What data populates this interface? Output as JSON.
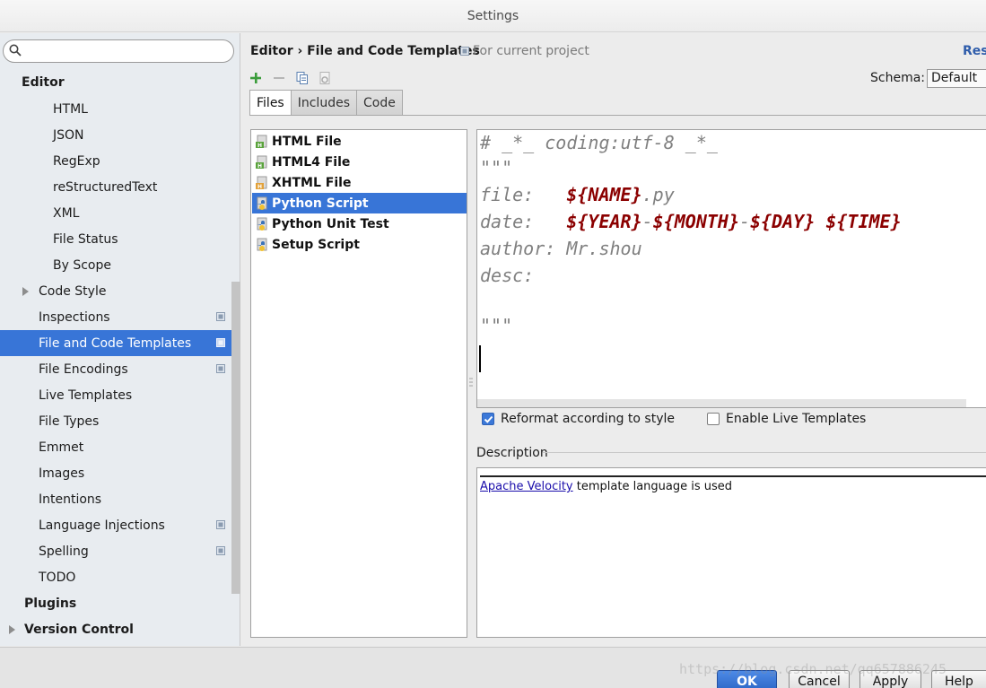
{
  "window": {
    "title": "Settings"
  },
  "search": {
    "placeholder": "",
    "value": ""
  },
  "tree": [
    {
      "label": "Editor",
      "bold": true
    },
    {
      "label": "HTML"
    },
    {
      "label": "JSON"
    },
    {
      "label": "RegExp"
    },
    {
      "label": "reStructuredText"
    },
    {
      "label": "XML"
    },
    {
      "label": "File Status"
    },
    {
      "label": "By Scope"
    },
    {
      "label": "Code Style",
      "expandable": true
    },
    {
      "label": "Inspections",
      "project_icon": true
    },
    {
      "label": "File and Code Templates",
      "selected": true,
      "project_icon": true
    },
    {
      "label": "File Encodings",
      "project_icon": true
    },
    {
      "label": "Live Templates"
    },
    {
      "label": "File Types"
    },
    {
      "label": "Emmet"
    },
    {
      "label": "Images"
    },
    {
      "label": "Intentions"
    },
    {
      "label": "Language Injections",
      "project_icon": true
    },
    {
      "label": "Spelling",
      "project_icon": true
    },
    {
      "label": "TODO"
    },
    {
      "label": "Plugins",
      "bold": true
    },
    {
      "label": "Version Control",
      "bold": true,
      "expandable": true
    }
  ],
  "header": {
    "breadcrumb": "Editor › File and Code Templates",
    "scope": "For current project",
    "reset": "Res"
  },
  "schema": {
    "label": "Schema:",
    "value": "Default"
  },
  "tabs": [
    "Files",
    "Includes",
    "Code"
  ],
  "files": [
    {
      "label": "HTML File",
      "icon": "html-file-icon"
    },
    {
      "label": "HTML4 File",
      "icon": "html-file-icon"
    },
    {
      "label": "XHTML File",
      "icon": "xhtml-file-icon"
    },
    {
      "label": "Python Script",
      "icon": "python-file-icon",
      "selected": true
    },
    {
      "label": "Python Unit Test",
      "icon": "python-file-icon"
    },
    {
      "label": "Setup Script",
      "icon": "python-file-icon"
    }
  ],
  "code": {
    "line1": "# _*_ coding:utf-8 _*_",
    "line2": "\"\"\"",
    "file_label": "file:   ",
    "file_var": "${NAME}",
    "file_ext": ".py",
    "date_label": "date:   ",
    "v_year": "${YEAR}",
    "dash1": "-",
    "v_month": "${MONTH}",
    "dash2": "-",
    "v_day": "${DAY}",
    "sp": " ",
    "v_time": "${TIME}",
    "author": "author: Mr.shou",
    "desc": "desc:",
    "line_end": "\"\"\""
  },
  "options": {
    "reformat": {
      "label": "Reformat according to style",
      "checked": true
    },
    "live_templates": {
      "label": "Enable Live Templates",
      "checked": false
    }
  },
  "description": {
    "label": "Description",
    "link": "Apache Velocity",
    "text": " template language is used"
  },
  "buttons": {
    "ok": "OK",
    "cancel": "Cancel",
    "apply": "Apply",
    "help": "Help"
  },
  "watermark": "https://blog.csdn.net/qq657886245",
  "colors": {
    "accent": "#3875d7",
    "variable": "#8b0000",
    "comment": "#808080",
    "link": "#1a0dab"
  }
}
